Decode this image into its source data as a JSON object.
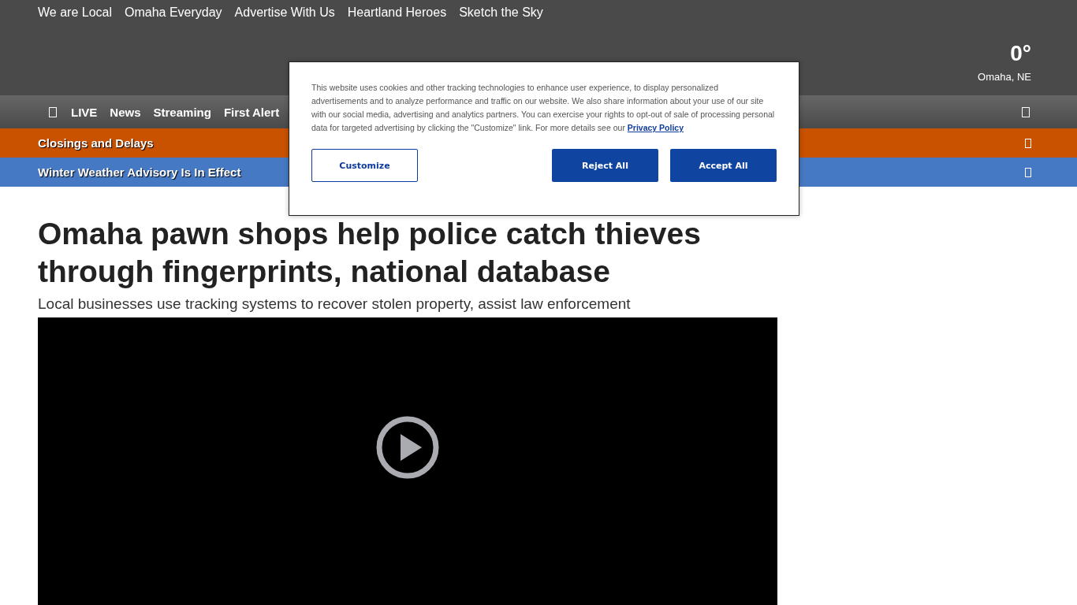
{
  "top_links": [
    "We are Local",
    "Omaha Everyday",
    "Advertise With Us",
    "Heartland Heroes",
    "Sketch the Sky"
  ],
  "weather": {
    "temperature": "0°",
    "location": "Omaha, NE"
  },
  "nav": {
    "items": [
      "LIVE",
      "News",
      "Streaming",
      "First Alert"
    ]
  },
  "alerts": [
    {
      "label": "Closings and Delays",
      "color": "#c85200"
    },
    {
      "label": "Winter Weather Advisory Is In Effect",
      "color": "#4679c4"
    }
  ],
  "article": {
    "headline": "Omaha pawn shops help police catch thieves through fingerprints, national database",
    "subheadline": "Local businesses use tracking systems to recover stolen property, assist law enforcement"
  },
  "cookie_banner": {
    "text": "This website uses cookies and other tracking technologies to enhance user experience, to display personalized advertisements and to analyze performance and traffic on our website. We also share information about your use of our site with our social media, advertising and analytics partners. You can exercise your rights to opt-out of sale of processing personal data for targeted advertising by clicking the \"Customize\" link. For more details see our",
    "link": "Privacy Policy",
    "buttons": [
      {
        "label": "Customize",
        "kind": "outline"
      },
      {
        "label": "Reject All",
        "kind": "solid"
      },
      {
        "label": "Accept All",
        "kind": "solid"
      }
    ]
  }
}
